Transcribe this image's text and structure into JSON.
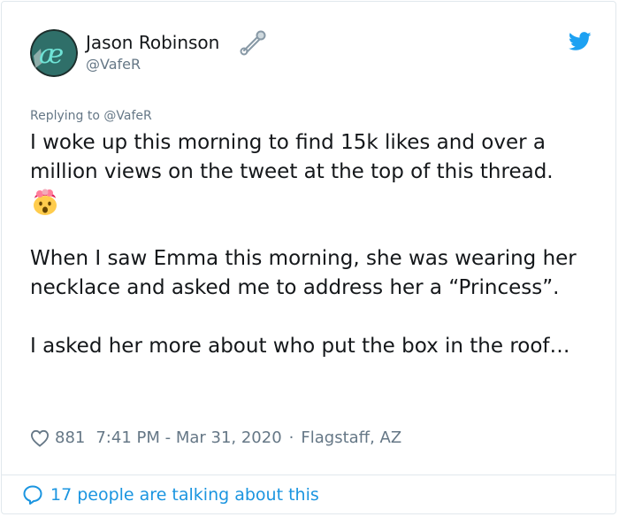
{
  "author": {
    "name": "Jason Robinson",
    "handle": "@VafeR",
    "avatar_icon": "avatar-ae-logo",
    "badge_icon": "safety-pin-icon"
  },
  "brand": {
    "icon": "twitter-bird-icon",
    "color": "#1da1f2"
  },
  "replying_to": "Replying to @VafeR",
  "tweet": {
    "paragraph1": "I woke up this morning to find 15k likes and over a million views on the tweet at the top of this thread.",
    "emoji_icon": "exploding-head-emoji-icon",
    "paragraph2": "When I saw Emma this morning, she was wearing her necklace and asked me to address her a “Princess”.",
    "paragraph3": "I asked her more about who put the box in the roof…"
  },
  "meta": {
    "likes": "881",
    "timestamp": "7:41 PM - Mar 31, 2020",
    "separator": "·",
    "location": "Flagstaff, AZ"
  },
  "footer": {
    "talking_text": "17 people are talking about this",
    "link_color": "#1b95e0"
  }
}
